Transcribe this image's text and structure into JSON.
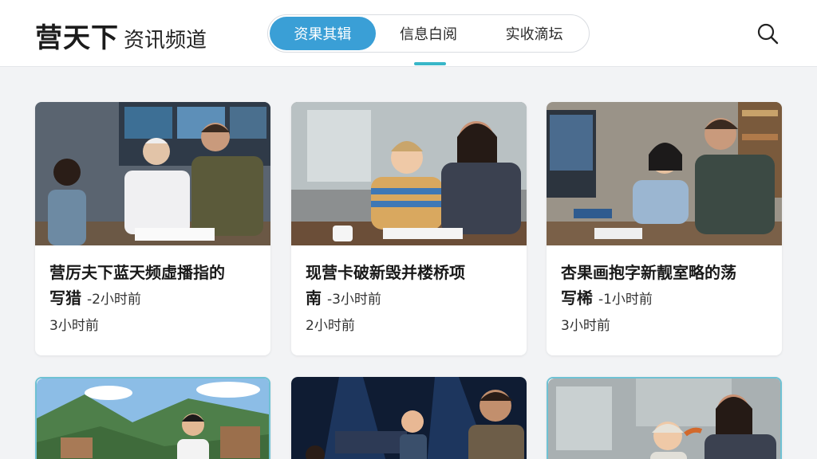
{
  "header": {
    "logo_main": "营天下",
    "logo_sub": "资讯频道",
    "tabs": [
      {
        "label": "资果其辑",
        "active": true
      },
      {
        "label": "信息白阅",
        "active": false
      },
      {
        "label": "实收滴坛",
        "active": false
      }
    ],
    "accent": "#3a9fd6",
    "indicator": "#38b6c8"
  },
  "cards": [
    {
      "title": "营厉夫下蓝天频虛播指的",
      "title2": "写猎",
      "meta": "-2小时前",
      "time": "3小时前",
      "image": "family-doctor-office"
    },
    {
      "title": "现营卡破新毁并楼桥项",
      "title2": "南",
      "meta": "-3小时前",
      "time": "2小时前",
      "image": "child-mother-reading"
    },
    {
      "title": "杏果画抱字新靓室略的荡",
      "title2": "写桸",
      "meta": "-1小时前",
      "time": "3小时前",
      "image": "family-lab-monitor"
    },
    {
      "image": "mountain-village-boy"
    },
    {
      "image": "stage-kids-man"
    },
    {
      "image": "child-mother-office"
    }
  ]
}
